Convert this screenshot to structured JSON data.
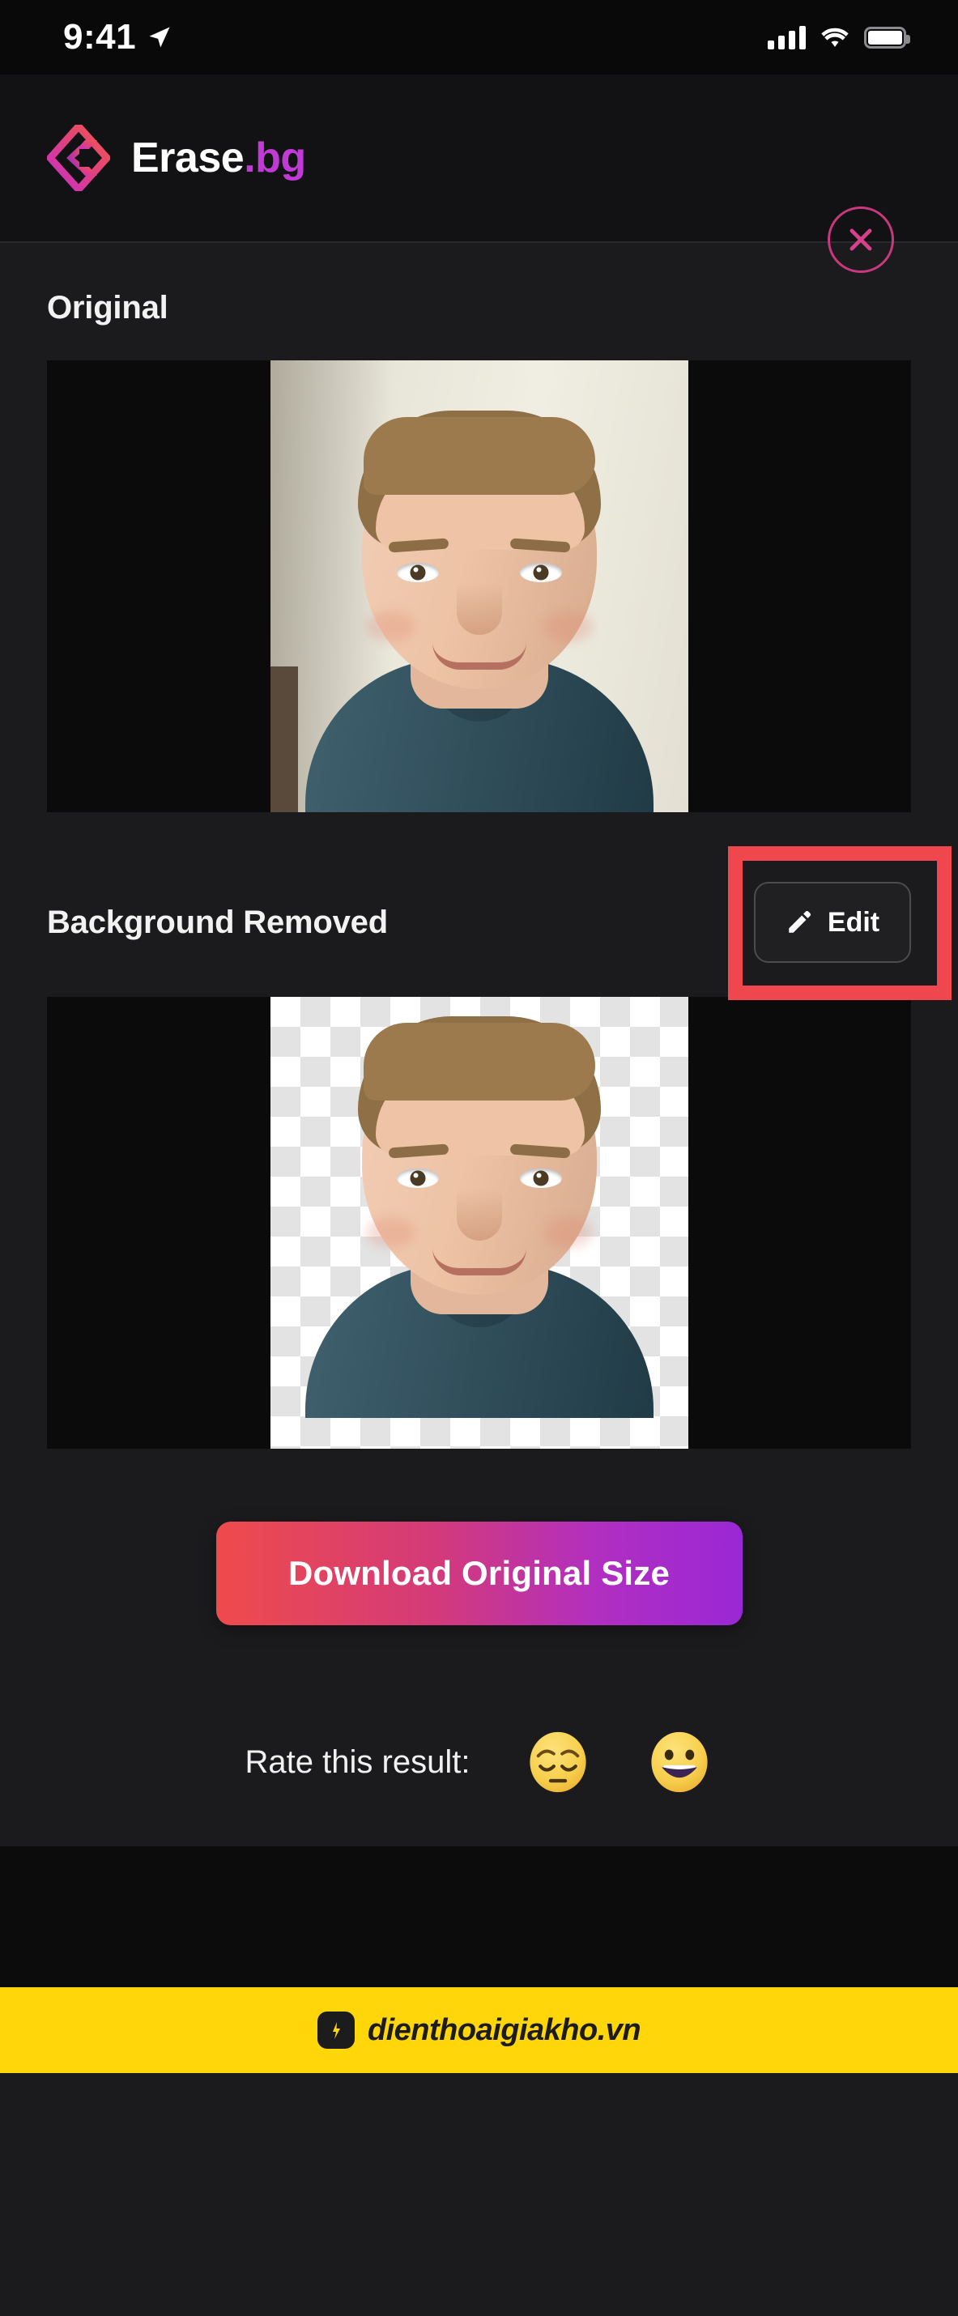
{
  "status_bar": {
    "time": "9:41",
    "location_icon": "location-arrow-icon",
    "signal_icon": "cellular-signal-icon",
    "wifi_icon": "wifi-icon",
    "battery_icon": "battery-full-icon"
  },
  "header": {
    "logo_icon": "erasebg-logo-icon",
    "brand_name": "Erase",
    "brand_suffix": ".bg",
    "close_label": "close-icon"
  },
  "sections": {
    "original": {
      "label": "Original"
    },
    "removed": {
      "label": "Background Removed",
      "edit_label": "Edit",
      "edit_icon": "pencil-icon"
    }
  },
  "download": {
    "label": "Download Original Size"
  },
  "rating": {
    "label": "Rate this result:",
    "options": [
      {
        "name": "pensive-face-emoji",
        "glyph": "😔"
      },
      {
        "name": "grinning-face-emoji",
        "glyph": "😀"
      }
    ]
  },
  "watermark": {
    "text": "dienthoaigiakho.vn",
    "icon": "phone-app-icon"
  },
  "colors": {
    "accent_pink": "#c9387e",
    "brand_purple": "#c23ad6",
    "highlight_red": "#f0474f",
    "watermark_yellow": "#ffd60a",
    "page_bg": "#1b1b1d",
    "panel_bg": "#0b0b0c"
  }
}
